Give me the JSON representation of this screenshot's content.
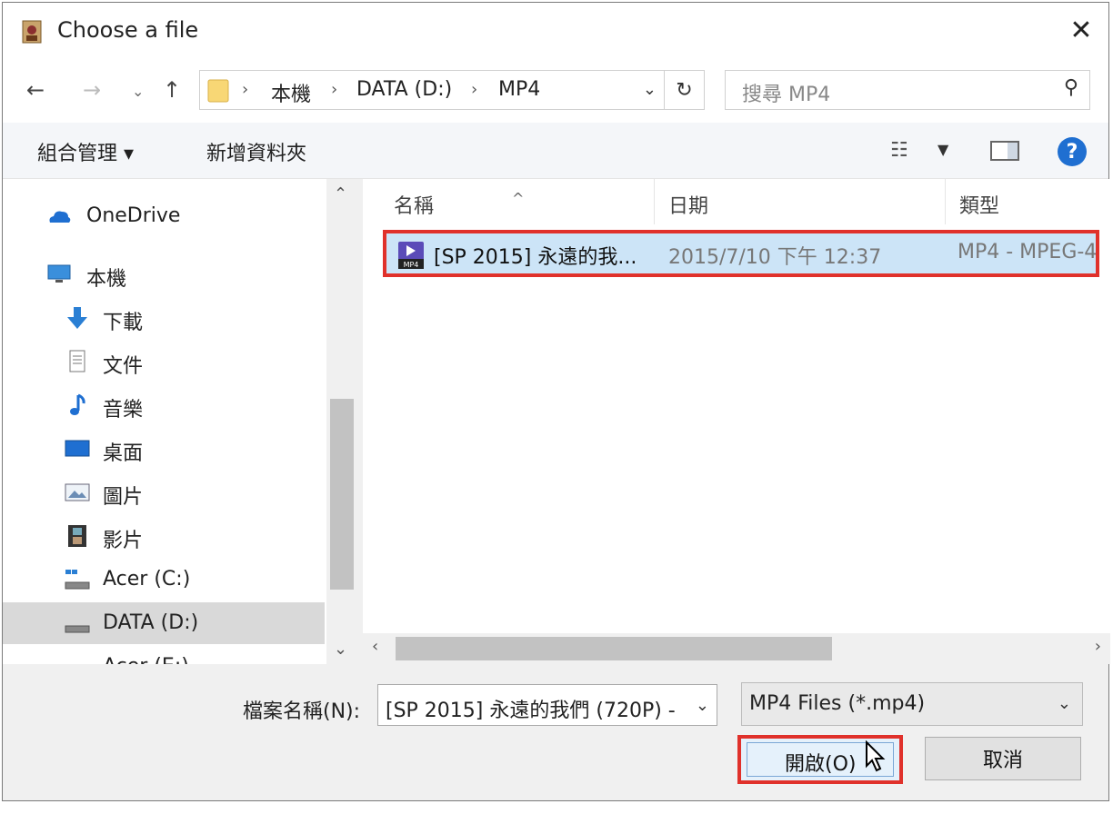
{
  "window": {
    "title": "Choose a file",
    "close_glyph": "✕"
  },
  "nav": {
    "back": "←",
    "forward": "→",
    "recent": "⌄",
    "up": "↑"
  },
  "address": {
    "crumbs": [
      "本機",
      "DATA (D:)",
      "MP4"
    ],
    "sep": "›",
    "dropdown": "⌄",
    "refresh": "↻"
  },
  "search": {
    "placeholder": "搜尋 MP4",
    "icon": "⚲"
  },
  "toolbar": {
    "organize": "組合管理 ▾",
    "new_folder": "新增資料夾",
    "view_icon": "☷",
    "view_drop": "▼",
    "help": "?"
  },
  "sidebar": {
    "items": [
      {
        "label": "OneDrive",
        "icon": "cloud-icon"
      },
      {
        "label": "本機",
        "icon": "computer-icon"
      },
      {
        "label": "下載",
        "icon": "download-icon"
      },
      {
        "label": "文件",
        "icon": "document-icon"
      },
      {
        "label": "音樂",
        "icon": "music-icon"
      },
      {
        "label": "桌面",
        "icon": "desktop-icon"
      },
      {
        "label": "圖片",
        "icon": "picture-icon"
      },
      {
        "label": "影片",
        "icon": "video-icon"
      },
      {
        "label": "Acer (C:)",
        "icon": "drive-icon"
      },
      {
        "label": "DATA (D:)",
        "icon": "drive-icon",
        "selected": true
      },
      {
        "label": "Acer (E:)",
        "icon": "drive-icon"
      }
    ],
    "scroll_up": "⌃",
    "scroll_down": "⌄"
  },
  "columns": {
    "name": "名稱",
    "date": "日期",
    "type": "類型",
    "sort": "^"
  },
  "files": [
    {
      "name": "[SP 2015] 永遠的我...",
      "date": "2015/7/10 下午 12:37",
      "type": "MP4 - MPEG-4",
      "icon": "mp4-file-icon"
    }
  ],
  "hscroll": {
    "left": "‹",
    "right": "›"
  },
  "bottom": {
    "filename_label": "檔案名稱(N):",
    "filename_value": "[SP 2015] 永遠的我們 (720P) -",
    "filetype_value": "MP4 Files (*.mp4)",
    "dropdown": "⌄",
    "open_label": "開啟(O)",
    "cancel_label": "取消"
  },
  "colors": {
    "highlight": "#e0312b",
    "selection": "#cce4f7",
    "accent": "#1f6fd1"
  }
}
